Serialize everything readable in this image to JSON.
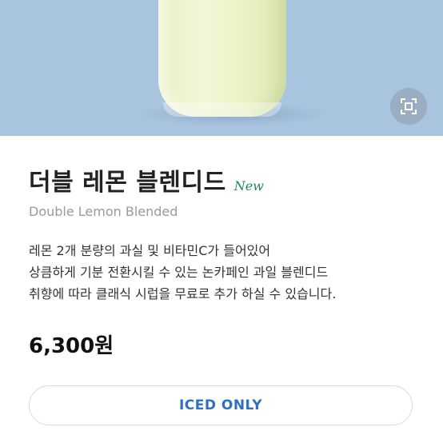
{
  "product": {
    "name_ko": "더블 레몬 블렌디드",
    "badge": "New",
    "name_en": "Double Lemon Blended",
    "description_lines": [
      "레몬 2개 분량의 과실 및 비타민C가 들어있어",
      "상큼하게 기분 전환시킬 수 있는 논카페인 과일 블렌디드",
      "취향에 따라 클래식 시럽을 무료로 추가 하실 수 있습니다."
    ],
    "price": "6,300원"
  },
  "hero": {
    "background_color": "#a9c4df",
    "expand_icon": "expand-icon"
  },
  "option_button": {
    "label": "ICED ONLY"
  },
  "colors": {
    "badge": "#1f8a5b",
    "option_text": "#2f6fc4"
  }
}
